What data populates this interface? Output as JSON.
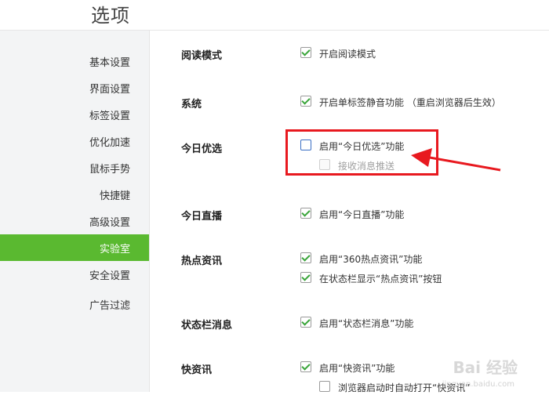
{
  "header": {
    "title": "选项"
  },
  "sidebar": {
    "items": [
      {
        "label": "基本设置"
      },
      {
        "label": "界面设置"
      },
      {
        "label": "标签设置"
      },
      {
        "label": "优化加速"
      },
      {
        "label": "鼠标手势"
      },
      {
        "label": "快捷键"
      },
      {
        "label": "高级设置"
      },
      {
        "label": "实验室",
        "active": true
      },
      {
        "label": "安全设置"
      },
      {
        "label": "广告过滤"
      }
    ]
  },
  "sections": [
    {
      "label": "阅读模式",
      "options": [
        {
          "text": "开启阅读模式",
          "checked": true
        }
      ]
    },
    {
      "label": "系统",
      "options": [
        {
          "text": "开启单标签静音功能 （重启浏览器后生效）",
          "checked": true
        }
      ]
    },
    {
      "label": "今日优选",
      "options": [
        {
          "text": "启用“今日优选”功能",
          "checked": false
        },
        {
          "text": "接收消息推送",
          "checked": false,
          "disabled": true
        }
      ]
    },
    {
      "label": "今日直播",
      "options": [
        {
          "text": "启用“今日直播”功能",
          "checked": true
        }
      ]
    },
    {
      "label": "热点资讯",
      "options": [
        {
          "text": "启用“360热点资讯”功能",
          "checked": true
        },
        {
          "text": "在状态栏显示“热点资讯”按钮",
          "checked": true
        }
      ]
    },
    {
      "label": "状态栏消息",
      "options": [
        {
          "text": "启用“状态栏消息”功能",
          "checked": true
        }
      ]
    },
    {
      "label": "快资讯",
      "options": [
        {
          "text": "启用“快资讯”功能",
          "checked": true
        },
        {
          "text": "浏览器启动时自动打开“快资讯”",
          "checked": false
        }
      ]
    }
  ],
  "annotation": {
    "color": "#e8191f"
  },
  "watermark": {
    "text": "Bai 经验",
    "sub": "jingyan.baidu.com"
  },
  "colors": {
    "accent": "#5ab930",
    "check": "#3aa53a",
    "highlight": "#e8191f"
  }
}
